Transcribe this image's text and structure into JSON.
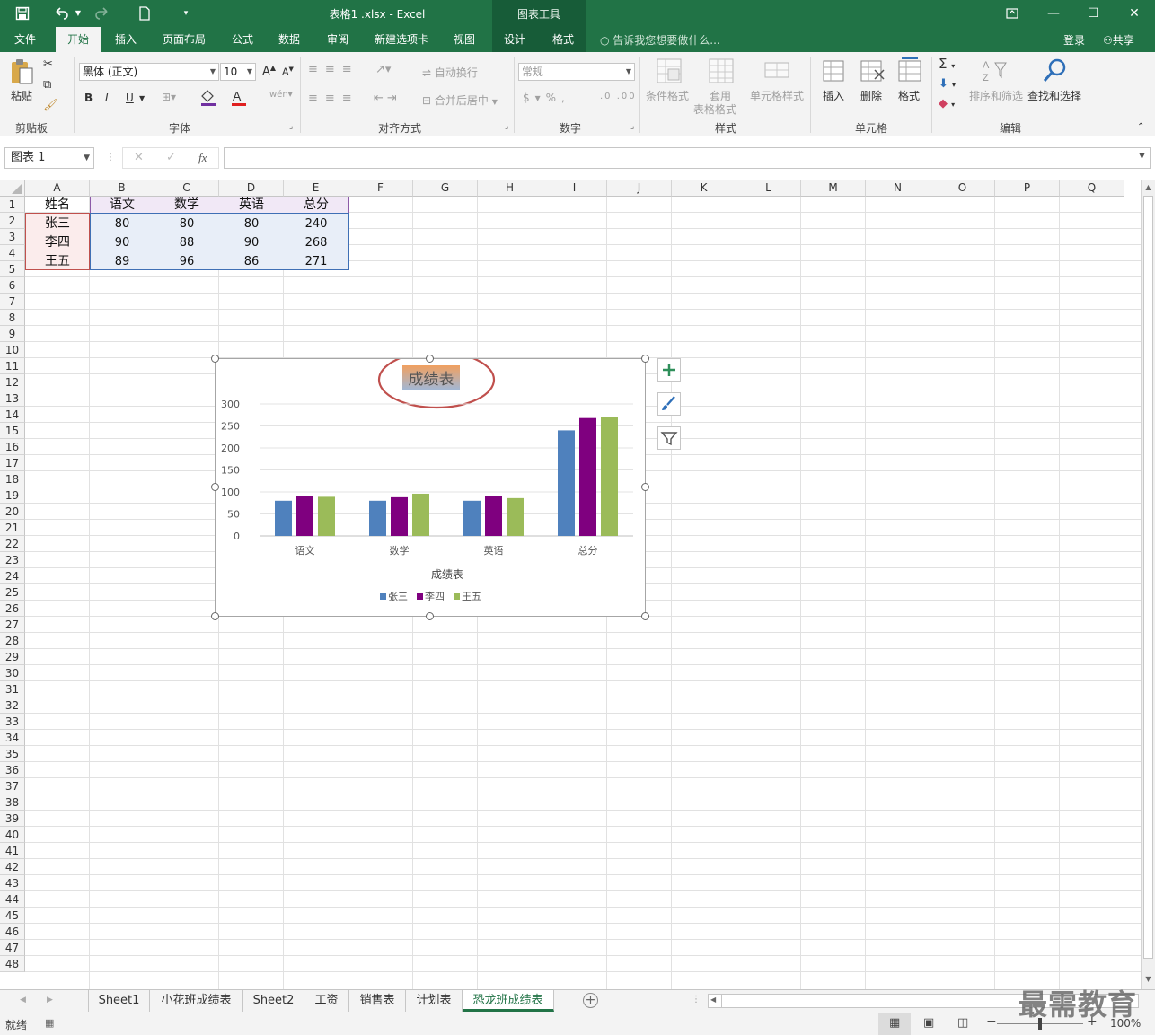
{
  "titlebar": {
    "title": "表格1 .xlsx - Excel",
    "chart_tools": "图表工具",
    "save_icon": "save-icon",
    "undo_icon": "undo-icon",
    "redo_icon": "redo-icon",
    "new_icon": "new-doc-icon",
    "customize_icon": "customize-icon"
  },
  "tabs": [
    {
      "label": "文件"
    },
    {
      "label": "开始"
    },
    {
      "label": "插入"
    },
    {
      "label": "页面布局"
    },
    {
      "label": "公式"
    },
    {
      "label": "数据"
    },
    {
      "label": "审阅"
    },
    {
      "label": "新建选项卡"
    },
    {
      "label": "视图"
    },
    {
      "label": "设计"
    },
    {
      "label": "格式"
    }
  ],
  "tell_me": "告诉我您想要做什么...",
  "login": "登录",
  "share": "共享",
  "ribbon": {
    "clipboard": {
      "label": "剪贴板",
      "paste": "粘贴"
    },
    "font": {
      "label": "字体",
      "name": "黑体 (正文)",
      "size": "10",
      "bold": "B",
      "italic": "I",
      "underline": "U"
    },
    "alignment": {
      "label": "对齐方式",
      "wrap": "自动换行",
      "merge": "合并后居中"
    },
    "number": {
      "label": "数字",
      "format": "常规"
    },
    "styles": {
      "label": "样式",
      "conditional": "条件格式",
      "table_line1": "套用",
      "table_line2": "表格格式",
      "cell_styles": "单元格样式"
    },
    "cells": {
      "label": "单元格",
      "insert": "插入",
      "delete": "删除",
      "format": "格式"
    },
    "editing": {
      "label": "编辑",
      "sort": "排序和筛选",
      "find": "查找和选择"
    }
  },
  "formula": {
    "namebox": "图表 1",
    "fx": "fx",
    "value": ""
  },
  "columns": [
    "A",
    "B",
    "C",
    "D",
    "E",
    "F",
    "G",
    "H",
    "I",
    "J",
    "K",
    "L",
    "M",
    "N",
    "O",
    "P",
    "Q"
  ],
  "rows": [
    "1",
    "2",
    "3",
    "4",
    "5",
    "6",
    "7",
    "8",
    "9",
    "10",
    "11",
    "12",
    "13",
    "14",
    "15",
    "16",
    "17",
    "18",
    "19",
    "20",
    "21",
    "22",
    "23",
    "24",
    "25",
    "26",
    "27",
    "28",
    "29",
    "30",
    "31",
    "32",
    "33",
    "34",
    "35",
    "36",
    "37",
    "38",
    "39",
    "40",
    "41",
    "42",
    "43",
    "44",
    "45",
    "46",
    "47",
    "48"
  ],
  "table": {
    "header": [
      "姓名",
      "语文",
      "数学",
      "英语",
      "总分"
    ],
    "rows": [
      [
        "张三",
        "80",
        "80",
        "80",
        "240"
      ],
      [
        "李四",
        "90",
        "88",
        "90",
        "268"
      ],
      [
        "王五",
        "89",
        "96",
        "86",
        "271"
      ]
    ]
  },
  "chart_data": {
    "type": "bar",
    "title": "成绩表",
    "xlabel": "成绩表",
    "ylabel": "",
    "categories": [
      "语文",
      "数学",
      "英语",
      "总分"
    ],
    "series": [
      {
        "name": "张三",
        "values": [
          80,
          80,
          80,
          240
        ],
        "color": "#4f81bd"
      },
      {
        "name": "李四",
        "values": [
          90,
          88,
          90,
          268
        ],
        "color": "#7f007f"
      },
      {
        "name": "王五",
        "values": [
          89,
          96,
          86,
          271
        ],
        "color": "#9bbb59"
      }
    ],
    "ylim": [
      0,
      300
    ],
    "yticks": [
      "0",
      "50",
      "100",
      "150",
      "200",
      "250",
      "300"
    ],
    "grid": true,
    "legend": "bottom"
  },
  "sheets": [
    {
      "name": "Sheet1"
    },
    {
      "name": "小花班成绩表"
    },
    {
      "name": "Sheet2"
    },
    {
      "name": "工资"
    },
    {
      "name": "销售表"
    },
    {
      "name": "计划表"
    },
    {
      "name": "恐龙班成绩表"
    }
  ],
  "active_sheet": "恐龙班成绩表",
  "status": {
    "ready": "就绪",
    "zoom": "100%"
  },
  "watermark": "最需教育",
  "colors": {
    "accent": "#217346",
    "title_highlight": "#c0504d"
  }
}
